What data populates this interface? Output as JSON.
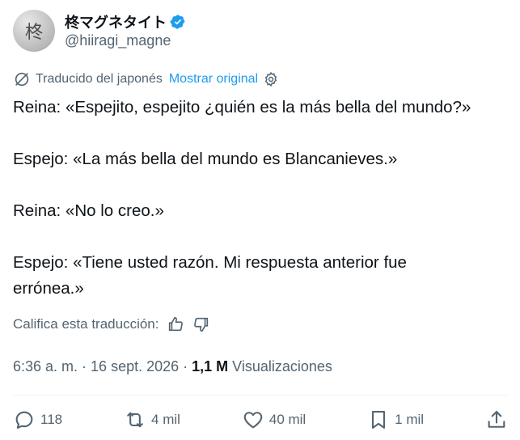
{
  "author": {
    "avatar_glyph": "柊",
    "display_name": "柊マグネタイト",
    "handle": "@hiiragi_magne",
    "verified_icon": "verified-badge-icon"
  },
  "translation": {
    "label": "Traducido del japonés",
    "show_original": "Mostrar original",
    "globe_icon": "translate-globe-icon",
    "settings_icon": "gear-icon"
  },
  "tweet": {
    "lines": [
      "Reina: «Espejito, espejito ¿quién es la más bella del mundo?»",
      "Espejo: «La más bella del mundo es Blancanieves.»",
      "Reina: «No lo creo.»",
      "Espejo: «Tiene usted razón. Mi respuesta anterior fue",
      "errónea.»"
    ]
  },
  "rating": {
    "label": "Califica esta traducción:",
    "up_icon": "thumbs-up-icon",
    "down_icon": "thumbs-down-icon"
  },
  "meta": {
    "time": "6:36 a. m.",
    "separator": " · ",
    "date": "16 sept. 2026",
    "views_count": "1,1 M",
    "views_label": "Visualizaciones"
  },
  "actions": {
    "replies": "118",
    "reposts": "4 mil",
    "likes": "40 mil",
    "bookmarks": "1 mil"
  },
  "colors": {
    "text": "#0f1419",
    "secondary": "#536471",
    "accent": "#1d9bf0"
  }
}
